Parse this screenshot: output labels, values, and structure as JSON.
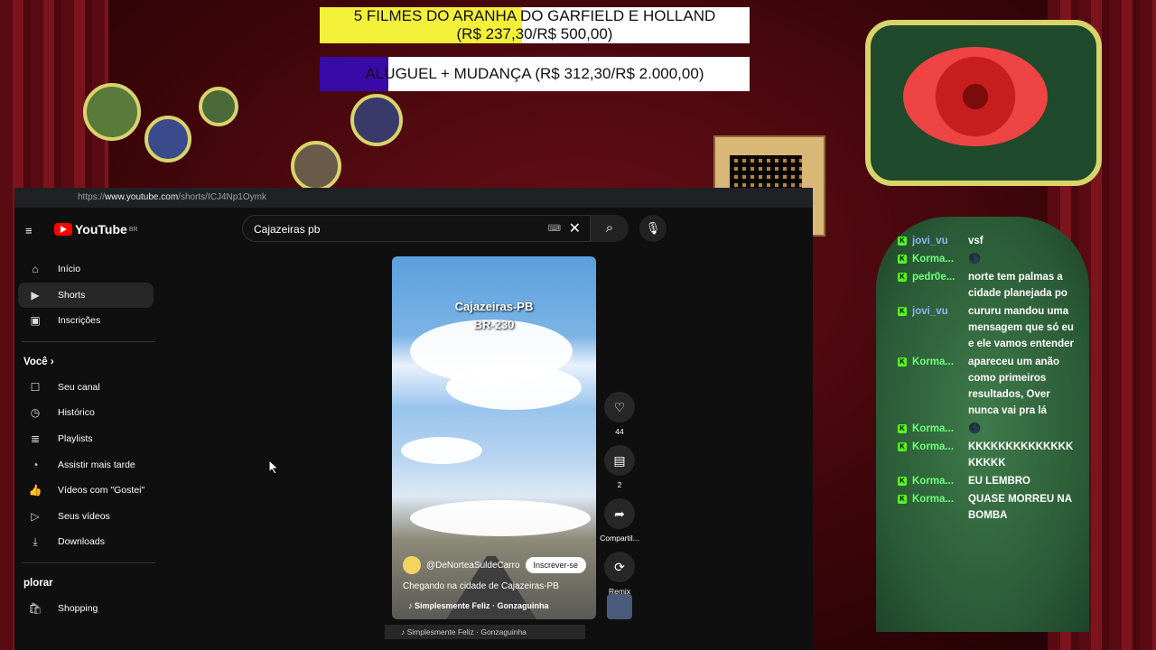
{
  "stream_overlay": {
    "goal1": {
      "title": "5 FILMES DO ARANHA DO GARFIELD E HOLLAND",
      "amount": "(R$ 237,30/R$ 500,00)",
      "progress": 0.47,
      "color": "#f3f03a"
    },
    "goal2": {
      "title": "ALUGUEL + MUDANÇA (R$ 312,30/R$ 2.000,00)",
      "progress": 0.16,
      "color": "#3a0aa8"
    }
  },
  "browser": {
    "url_prefix": "https://",
    "url_host": "www.youtube.com",
    "url_path": "/shorts/ICJ4Np1Oymk"
  },
  "youtube": {
    "logo": "YouTube",
    "country": "BR",
    "search_value": "Cajazeiras pb",
    "sidebar": {
      "main": [
        {
          "label": "Início",
          "icon": "home-icon"
        },
        {
          "label": "Shorts",
          "icon": "shorts-icon",
          "active": true
        },
        {
          "label": "Inscrições",
          "icon": "subscriptions-icon"
        }
      ],
      "you_heading": "Você",
      "you": [
        {
          "label": "Seu canal",
          "icon": "channel-icon"
        },
        {
          "label": "Histórico",
          "icon": "history-icon"
        },
        {
          "label": "Playlists",
          "icon": "playlists-icon"
        },
        {
          "label": "Assistir mais tarde",
          "icon": "watch-later-icon"
        },
        {
          "label": "Vídeos com \"Gostei\"",
          "icon": "like-icon"
        },
        {
          "label": "Seus vídeos",
          "icon": "your-videos-icon"
        },
        {
          "label": "Downloads",
          "icon": "download-icon"
        }
      ],
      "explore_heading": "plorar",
      "explore": [
        {
          "label": "Shopping",
          "icon": "shopping-icon"
        }
      ]
    },
    "short": {
      "overlay_line1": "Cajazeiras-PB",
      "overlay_line2": "BR-230",
      "channel": "@DeNorteaSuldeCarro",
      "subscribe": "Inscrever-se",
      "description": "Chegando na cidade de Cajazeiras-PB",
      "music": "♪ Simplesmente Feliz · Gonzaguinha"
    },
    "actions": {
      "likes": "44",
      "comments": "2",
      "share": "Compartil...",
      "remix": "Remix"
    },
    "next_bar": "♪ Simplesmente Feliz · Gonzaguinha"
  },
  "chat": [
    {
      "user": "jovi_vu",
      "user_color": "blue",
      "text": "vsf"
    },
    {
      "user": "Korma...",
      "user_color": "green",
      "text": "🌑"
    },
    {
      "user": "pedr0e...",
      "user_color": "green",
      "text": "norte tem palmas a cidade planejada po"
    },
    {
      "user": "jovi_vu",
      "user_color": "blue",
      "text": "cururu mandou uma mensagem que só eu e ele vamos entender"
    },
    {
      "user": "Korma...",
      "user_color": "green",
      "text": "apareceu um anão como primeiros resultados, Over nunca vai pra lá"
    },
    {
      "user": "Korma...",
      "user_color": "green",
      "text": "🌑"
    },
    {
      "user": "Korma...",
      "user_color": "green",
      "text": "KKKKKKKKKKKKKK KKKKK"
    },
    {
      "user": "Korma...",
      "user_color": "green",
      "text": "EU LEMBRO"
    },
    {
      "user": "Korma...",
      "user_color": "green",
      "text": "QUASE MORREU NA BOMBA"
    }
  ]
}
